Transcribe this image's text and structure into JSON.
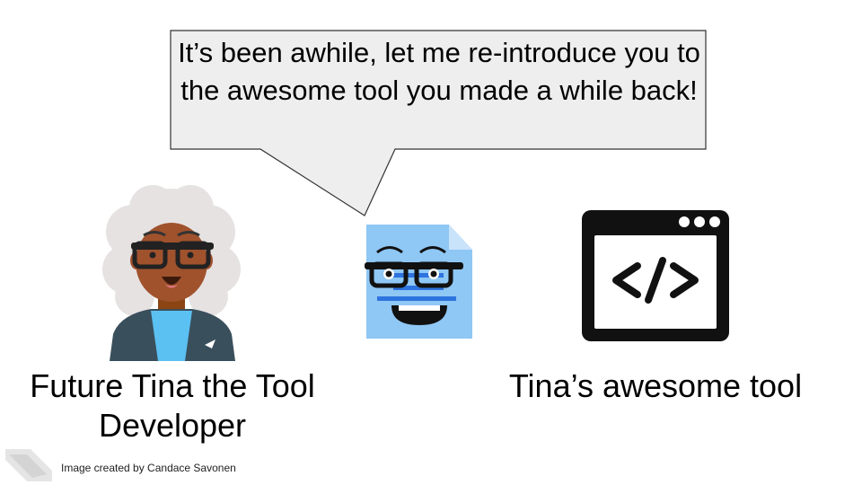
{
  "speech_bubble": {
    "text": "It’s been awhile, let me re-introduce you to the awesome tool you made a while back!"
  },
  "characters": {
    "tina": {
      "caption": "Future Tina the Tool Developer"
    },
    "tool": {
      "caption": "Tina’s awesome tool"
    }
  },
  "credit": "Image created by Candace Savonen",
  "colors": {
    "skin": "#a0522d",
    "hair": "#e6e2e2",
    "jacket": "#3a4f5c",
    "shirt": "#5bc0f2",
    "document": "#8fc7f5",
    "document_lines": "#2e74e0",
    "bubble_fill": "#eeeeee"
  }
}
